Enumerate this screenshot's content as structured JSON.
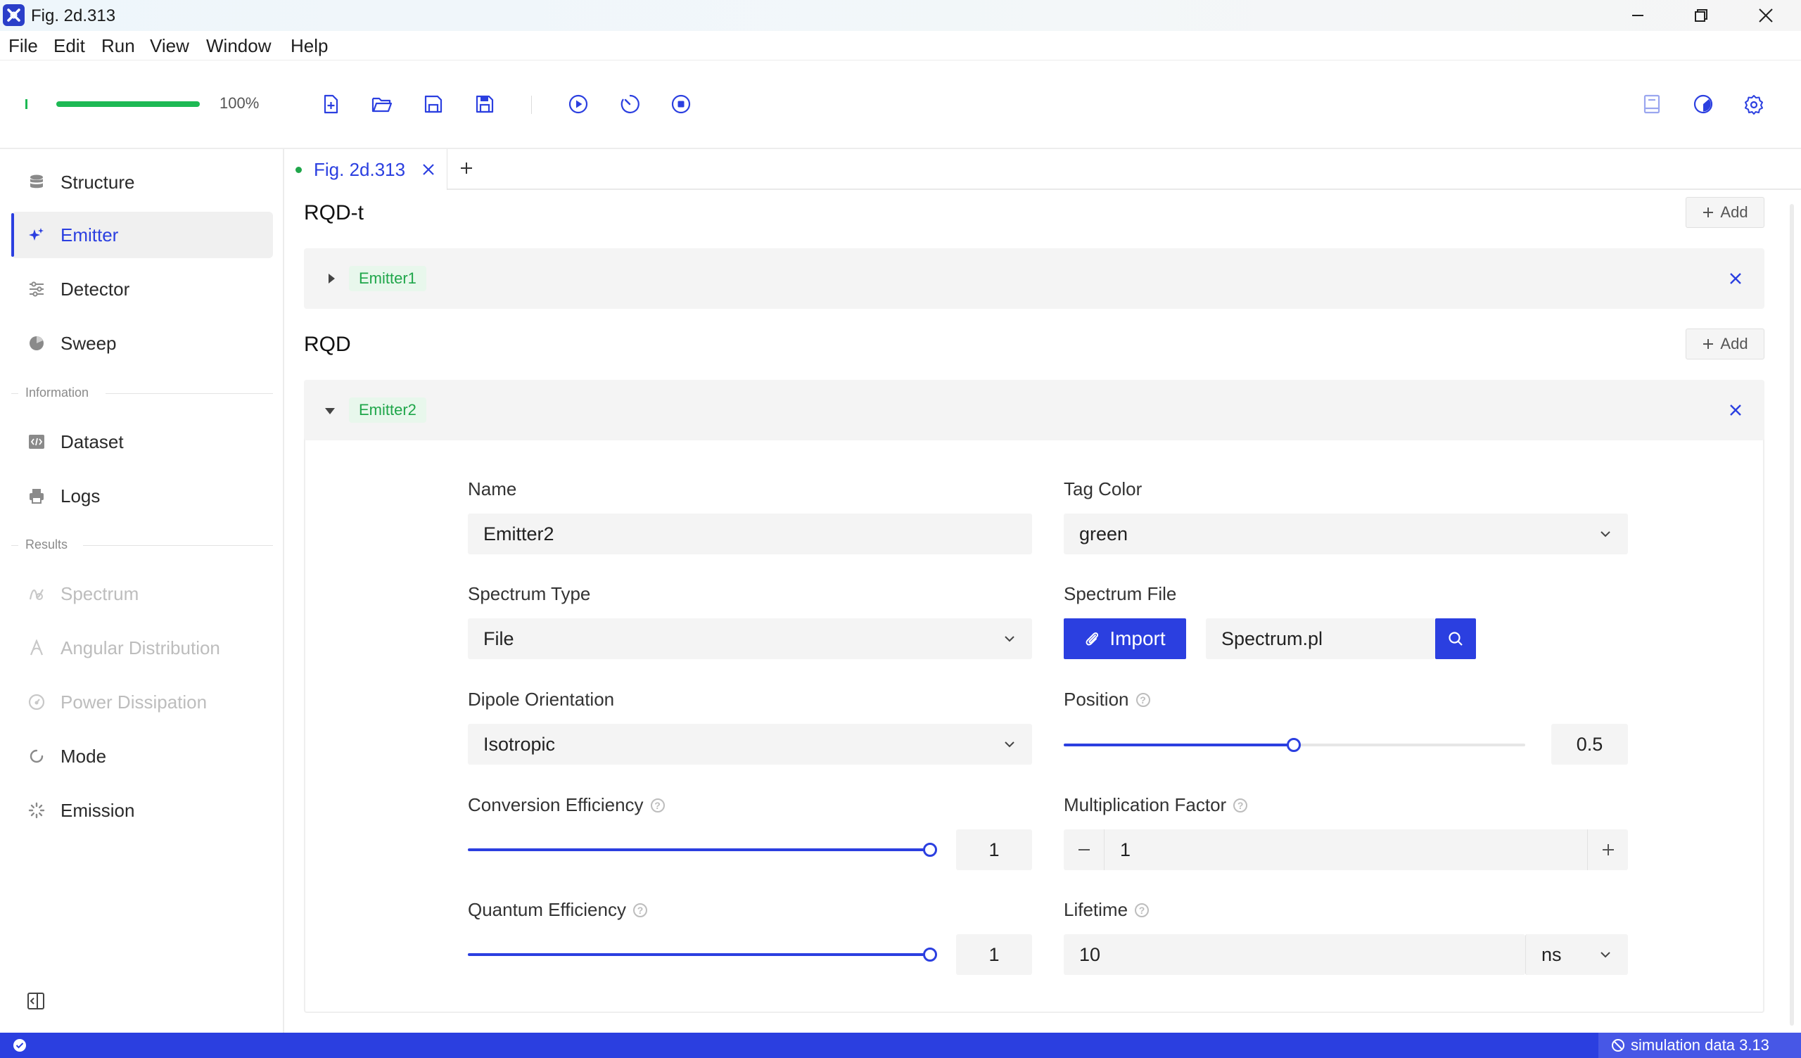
{
  "window": {
    "title": "Fig. 2d.313"
  },
  "menu": [
    "File",
    "Edit",
    "Run",
    "View",
    "Window",
    "Help"
  ],
  "toolbar": {
    "progress_value": 1.0,
    "progress_label": "100%"
  },
  "sidebar": {
    "items": [
      {
        "label": "Structure"
      },
      {
        "label": "Emitter"
      },
      {
        "label": "Detector"
      },
      {
        "label": "Sweep"
      }
    ],
    "info_label": "Information",
    "info_items": [
      {
        "label": "Dataset"
      },
      {
        "label": "Logs"
      }
    ],
    "results_label": "Results",
    "results_items": [
      {
        "label": "Spectrum"
      },
      {
        "label": "Angular Distribution"
      },
      {
        "label": "Power Dissipation"
      },
      {
        "label": "Mode"
      },
      {
        "label": "Emission"
      }
    ]
  },
  "tabs": [
    {
      "label": "Fig. 2d.313"
    }
  ],
  "sections": [
    {
      "title": "RQD-t",
      "add_label": "Add",
      "emitter_tag": "Emitter1"
    },
    {
      "title": "RQD",
      "add_label": "Add",
      "emitter_tag": "Emitter2"
    }
  ],
  "form": {
    "name_label": "Name",
    "name_value": "Emitter2",
    "tag_color_label": "Tag Color",
    "tag_color_value": "green",
    "spectrum_type_label": "Spectrum Type",
    "spectrum_type_value": "File",
    "spectrum_file_label": "Spectrum File",
    "import_label": "Import",
    "spectrum_file_value": "Spectrum.pl",
    "dipole_label": "Dipole Orientation",
    "dipole_value": "Isotropic",
    "position_label": "Position",
    "position_value": "0.5",
    "conversion_label": "Conversion Efficiency",
    "conversion_value": "1",
    "multiplication_label": "Multiplication Factor",
    "multiplication_value": "1",
    "quantum_label": "Quantum Efficiency",
    "quantum_value": "1",
    "lifetime_label": "Lifetime",
    "lifetime_value": "10",
    "lifetime_unit": "ns"
  },
  "status": {
    "text": "simulation data 3.13"
  },
  "colors": {
    "accent": "#2b3fe0",
    "tag_green": "#1fa64a",
    "progress_green": "#1db954"
  }
}
